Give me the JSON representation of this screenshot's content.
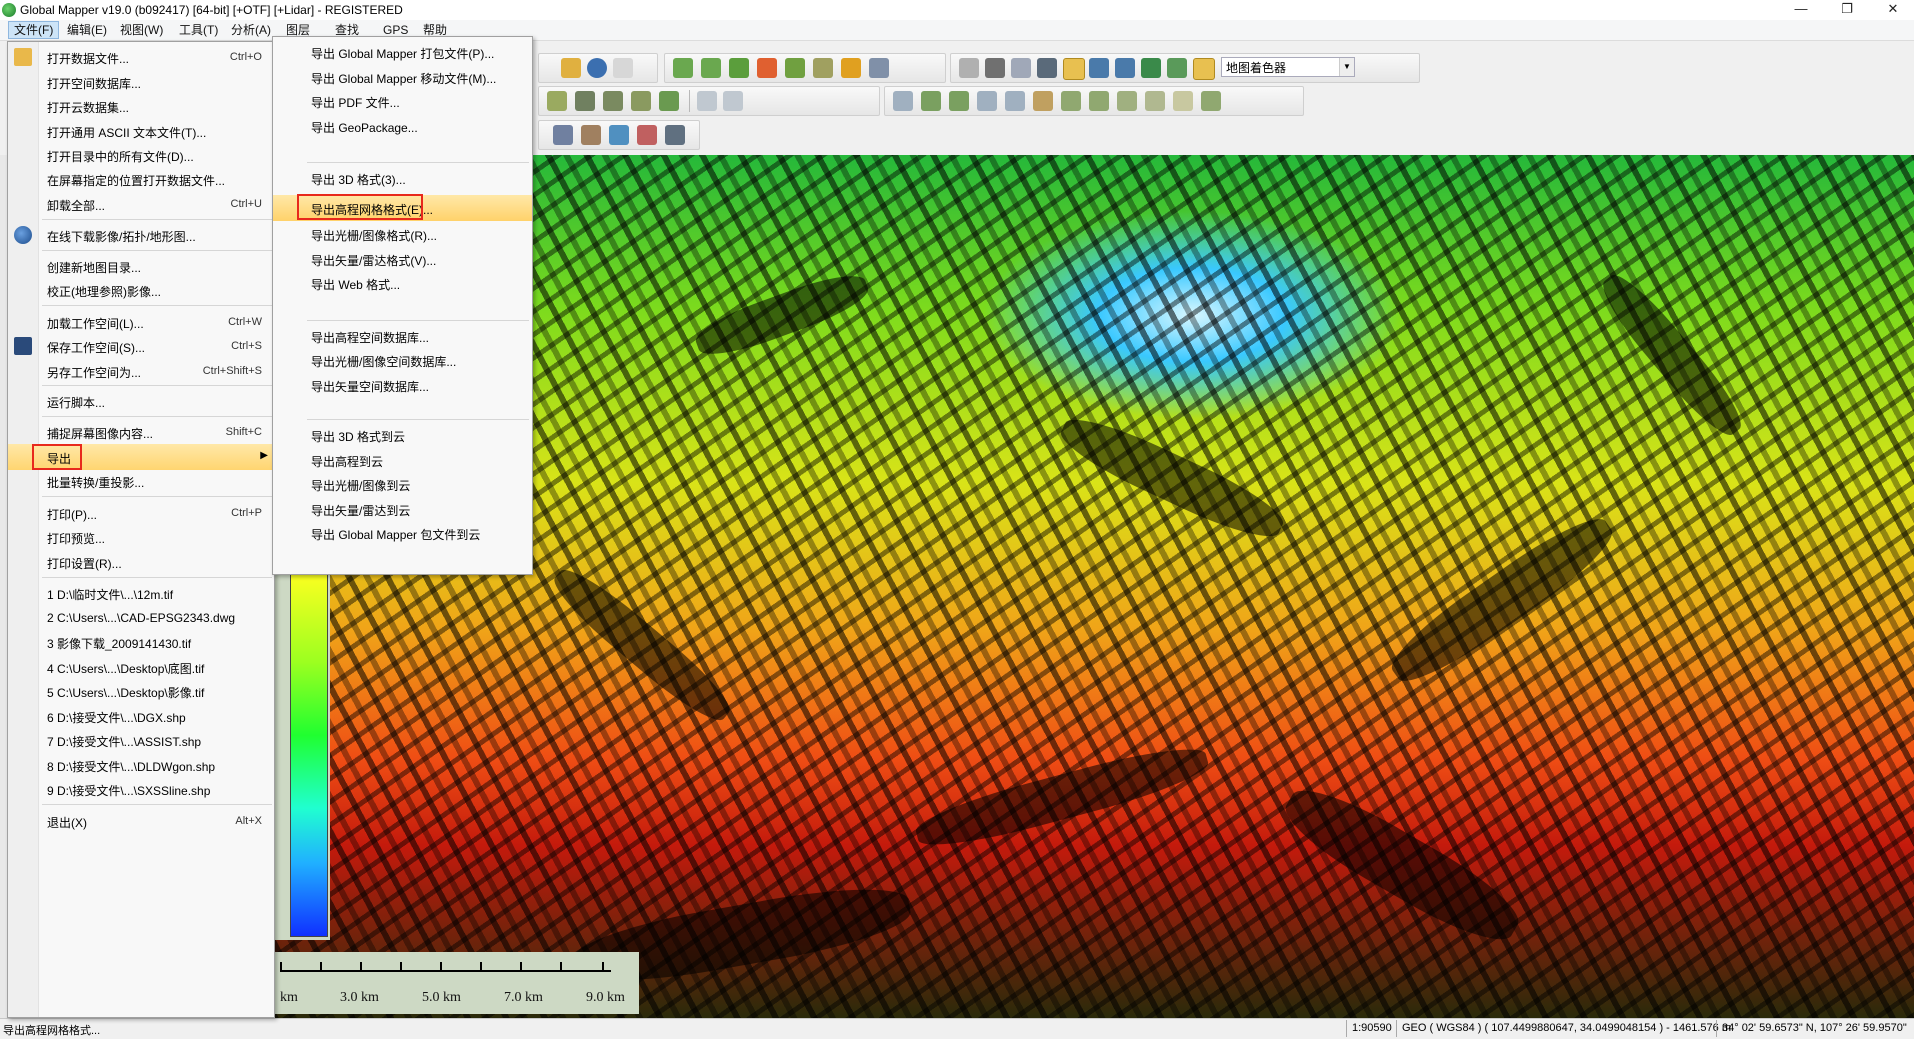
{
  "window": {
    "title": "Global Mapper v19.0 (b092417) [64-bit] [+OTF] [+Lidar] - REGISTERED",
    "minimize": "—",
    "maximize": "❐",
    "close": "✕"
  },
  "menubar": [
    {
      "label": "文件(F)"
    },
    {
      "label": "编辑(E)"
    },
    {
      "label": "视图(W)"
    },
    {
      "label": "工具(T)"
    },
    {
      "label": "分析(A)"
    },
    {
      "label": "图层"
    },
    {
      "label": "查找"
    },
    {
      "label": "GPS"
    },
    {
      "label": "帮助"
    }
  ],
  "toolbar": {
    "shader_combo": "地图着色器"
  },
  "file_menu": {
    "items": [
      {
        "label": "打开数据文件...",
        "shortcut": "Ctrl+O"
      },
      {
        "label": "打开空间数据库...",
        "shortcut": ""
      },
      {
        "label": "打开云数据集...",
        "shortcut": ""
      },
      {
        "label": "打开通用 ASCII 文本文件(T)...",
        "shortcut": ""
      },
      {
        "label": "打开目录中的所有文件(D)...",
        "shortcut": ""
      },
      {
        "label": "在屏幕指定的位置打开数据文件...",
        "shortcut": ""
      },
      {
        "label": "卸载全部...",
        "shortcut": "Ctrl+U"
      },
      {
        "label": "在线下载影像/拓扑/地形图...",
        "shortcut": ""
      },
      {
        "label": "创建新地图目录...",
        "shortcut": ""
      },
      {
        "label": "校正(地理参照)影像...",
        "shortcut": ""
      },
      {
        "label": "加载工作空间(L)...",
        "shortcut": "Ctrl+W"
      },
      {
        "label": "保存工作空间(S)...",
        "shortcut": "Ctrl+S"
      },
      {
        "label": "另存工作空间为...",
        "shortcut": "Ctrl+Shift+S"
      },
      {
        "label": "运行脚本...",
        "shortcut": ""
      },
      {
        "label": "捕捉屏幕图像内容...",
        "shortcut": "Shift+C"
      },
      {
        "label": "导出",
        "shortcut": ""
      },
      {
        "label": "批量转换/重投影...",
        "shortcut": ""
      },
      {
        "label": "打印(P)...",
        "shortcut": "Ctrl+P"
      },
      {
        "label": "打印预览...",
        "shortcut": ""
      },
      {
        "label": "打印设置(R)...",
        "shortcut": ""
      },
      {
        "label": "1 D:\\临时文件\\...\\12m.tif",
        "shortcut": ""
      },
      {
        "label": "2 C:\\Users\\...\\CAD-EPSG2343.dwg",
        "shortcut": ""
      },
      {
        "label": "3 影像下载_2009141430.tif",
        "shortcut": ""
      },
      {
        "label": "4 C:\\Users\\...\\Desktop\\底图.tif",
        "shortcut": ""
      },
      {
        "label": "5 C:\\Users\\...\\Desktop\\影像.tif",
        "shortcut": ""
      },
      {
        "label": "6 D:\\接受文件\\...\\DGX.shp",
        "shortcut": ""
      },
      {
        "label": "7 D:\\接受文件\\...\\ASSIST.shp",
        "shortcut": ""
      },
      {
        "label": "8 D:\\接受文件\\...\\DLDWgon.shp",
        "shortcut": ""
      },
      {
        "label": "9 D:\\接受文件\\...\\SXSSline.shp",
        "shortcut": ""
      },
      {
        "label": "退出(X)",
        "shortcut": "Alt+X"
      }
    ],
    "submenu_arrow": "▶"
  },
  "export_submenu": {
    "items": [
      {
        "label": "导出 Global Mapper 打包文件(P)..."
      },
      {
        "label": "导出 Global Mapper 移动文件(M)..."
      },
      {
        "label": "导出 PDF 文件..."
      },
      {
        "label": "导出 GeoPackage..."
      },
      {
        "label": "导出 3D 格式(3)..."
      },
      {
        "label": "导出高程网格格式(E)..."
      },
      {
        "label": "导出光栅/图像格式(R)..."
      },
      {
        "label": "导出矢量/雷达格式(V)..."
      },
      {
        "label": "导出 Web 格式..."
      },
      {
        "label": "导出高程空间数据库..."
      },
      {
        "label": "导出光栅/图像空间数据库..."
      },
      {
        "label": "导出矢量空间数据库..."
      },
      {
        "label": "导出 3D 格式到云"
      },
      {
        "label": "导出高程到云"
      },
      {
        "label": "导出光栅/图像到云"
      },
      {
        "label": "导出矢量/雷达到云"
      },
      {
        "label": "导出 Global Mapper 包文件到云"
      }
    ]
  },
  "scale_bar": {
    "labels": [
      "km",
      "3.0 km",
      "5.0 km",
      "7.0 km",
      "9.0 km"
    ]
  },
  "statusbar": {
    "hint": "导出高程网格格式...",
    "scale": "1:90590",
    "projection": "GEO ( WGS84 ) ( 107.4499880647, 34.0499048154 ) - 1461.576 m",
    "dms": "34° 02' 59.6573\" N, 107° 26' 59.9570\""
  },
  "colors": {
    "highlight": "#ffd570",
    "redbox": "#e8291c"
  }
}
